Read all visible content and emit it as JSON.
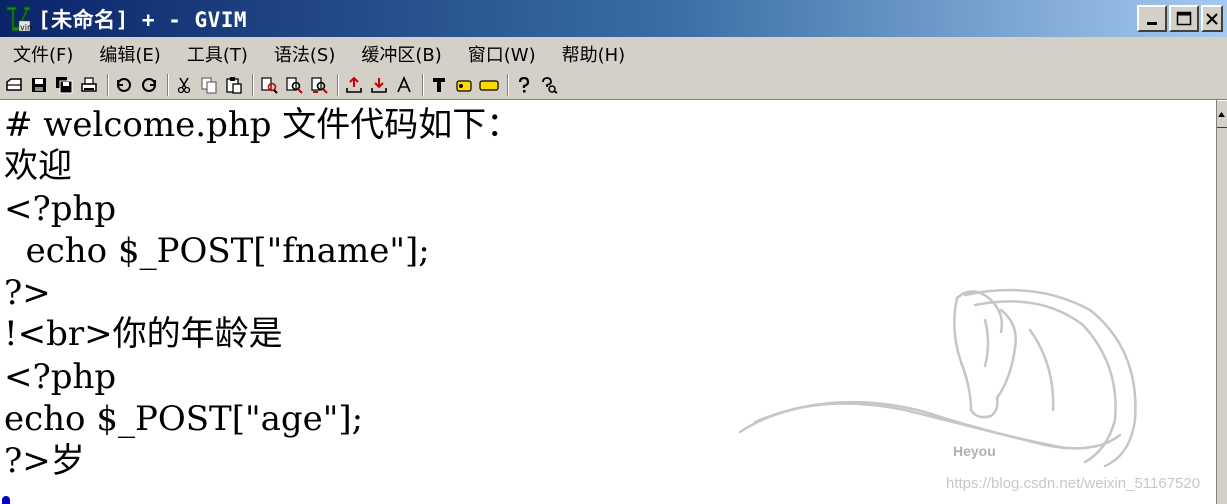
{
  "window": {
    "title": "[未命名] + - GVIM",
    "controls": [
      "minimize",
      "maximize",
      "close"
    ]
  },
  "menu": {
    "items": [
      "文件(F)",
      "编辑(E)",
      "工具(T)",
      "语法(S)",
      "缓冲区(B)",
      "窗口(W)",
      "帮助(H)"
    ]
  },
  "toolbar": {
    "buttons": [
      "open-icon",
      "save-icon",
      "save-all-icon",
      "print-icon",
      "undo-icon",
      "redo-icon",
      "cut-icon",
      "copy-icon",
      "paste-icon",
      "find-replace-icon",
      "find-next-icon",
      "find-prev-icon",
      "load-session-icon",
      "save-session-icon",
      "run-script-icon",
      "make-icon",
      "run-ctags-icon",
      "jump-tag-icon",
      "help-icon",
      "find-help-icon"
    ]
  },
  "editor": {
    "lines": [
      "# welcome.php 文件代码如下：",
      "欢迎",
      "<?php",
      "  echo $_POST[\"fname\"];",
      "?>",
      "!<br>你的年龄是",
      "<?php",
      "echo $_POST[\"age\"];",
      "?>岁"
    ]
  },
  "watermark": {
    "url": "https://blog.csdn.net/weixin_51167520"
  },
  "colors": {
    "titlebar_start": "#0a246a",
    "titlebar_end": "#a6caf0",
    "chrome": "#d4d0c8",
    "cursor": "#0000c0"
  }
}
